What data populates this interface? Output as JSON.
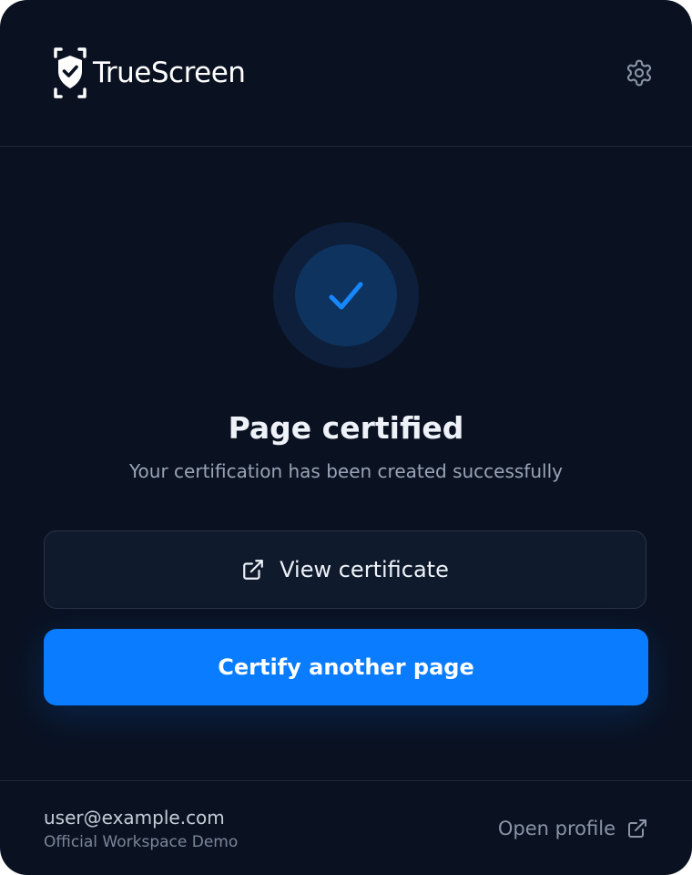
{
  "header": {
    "brand": "TrueScreen",
    "settings_icon": "gear-icon"
  },
  "status": {
    "icon": "check-icon",
    "title": "Page certified",
    "subtitle": "Your certification has been created successfully"
  },
  "actions": {
    "view_certificate_label": "View certificate",
    "view_certificate_icon": "external-link-icon",
    "certify_another_label": "Certify another page"
  },
  "footer": {
    "email": "user@example.com",
    "workspace": "Official Workspace Demo",
    "open_profile_label": "Open profile",
    "open_profile_icon": "external-link-icon"
  },
  "colors": {
    "background": "#0a1222",
    "accent": "#0a7cff",
    "text_primary": "#eef2f8",
    "text_muted": "#9aa4b6"
  }
}
